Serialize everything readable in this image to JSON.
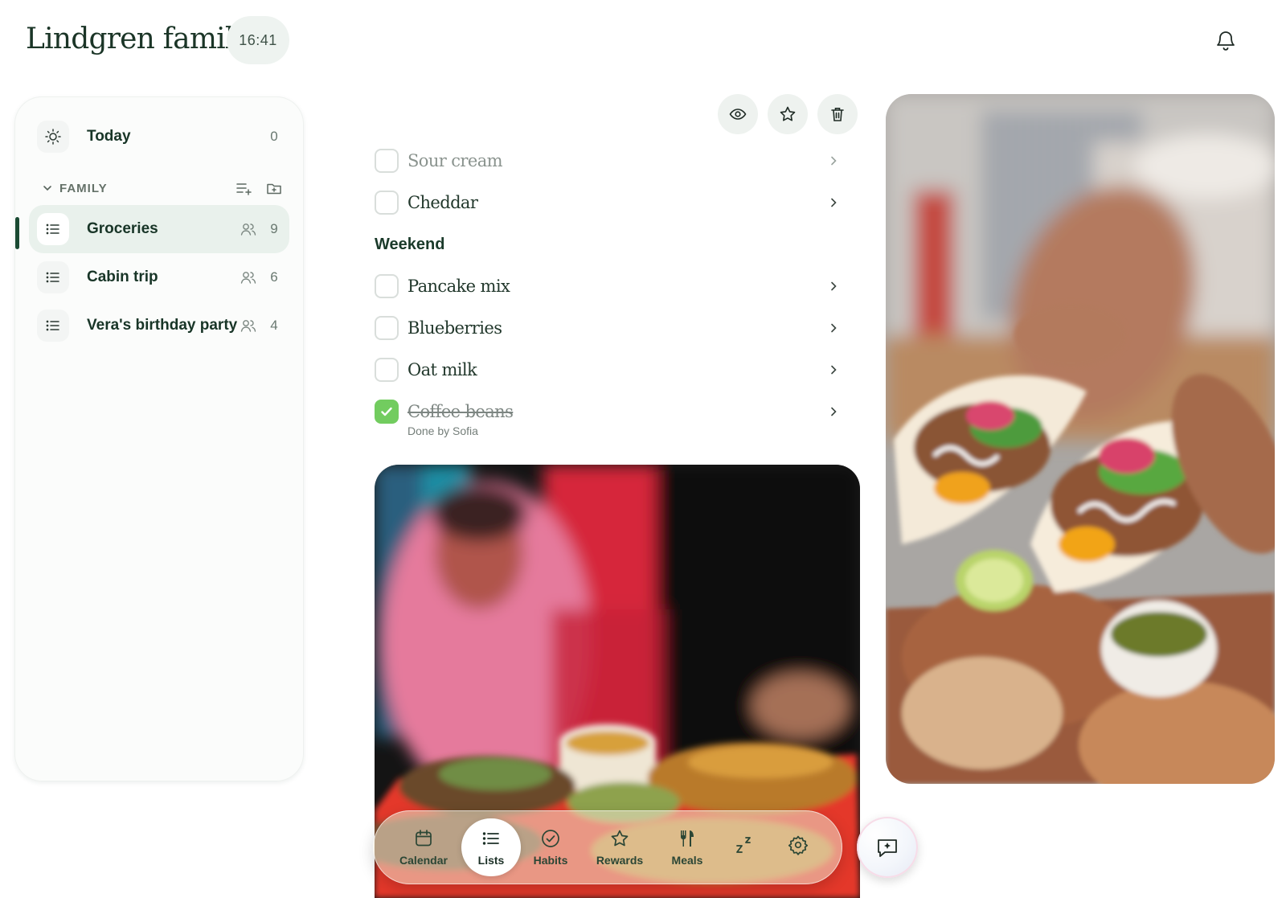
{
  "header": {
    "title": "Lindgren family",
    "time": "16:41"
  },
  "sidebar": {
    "today": {
      "label": "Today",
      "count": "0"
    },
    "section": {
      "label": "FAMILY"
    },
    "lists": [
      {
        "label": "Groceries",
        "count": "9",
        "active": true
      },
      {
        "label": "Cabin trip",
        "count": "6"
      },
      {
        "label": "Vera's birthday party",
        "count": "4"
      }
    ]
  },
  "toolbar": {
    "icons": [
      "eye-icon",
      "star-icon",
      "trash-icon"
    ]
  },
  "list": {
    "items_top": [
      {
        "label": "Sour cream",
        "faded": true
      },
      {
        "label": "Cheddar"
      }
    ],
    "group": "Weekend",
    "items_weekend": [
      {
        "label": "Pancake mix"
      },
      {
        "label": "Blueberries"
      },
      {
        "label": "Oat milk"
      },
      {
        "label": "Coffee beans",
        "done": true,
        "done_by": "Done by Sofia"
      }
    ]
  },
  "nav": {
    "items": [
      {
        "label": "Calendar",
        "icon": "calendar-icon"
      },
      {
        "label": "Lists",
        "icon": "list-icon",
        "selected": true
      },
      {
        "label": "Habits",
        "icon": "check-circle-icon"
      },
      {
        "label": "Rewards",
        "icon": "star-icon"
      },
      {
        "label": "Meals",
        "icon": "utensils-icon"
      },
      {
        "label": "",
        "icon": "sleep-icon"
      },
      {
        "label": "",
        "icon": "gear-icon"
      }
    ],
    "assistant_icon": "chat-sparkle-icon"
  },
  "colors": {
    "accent": "#1a4a33",
    "check": "#72cc5f",
    "active_bg": "#e9f1ec"
  }
}
